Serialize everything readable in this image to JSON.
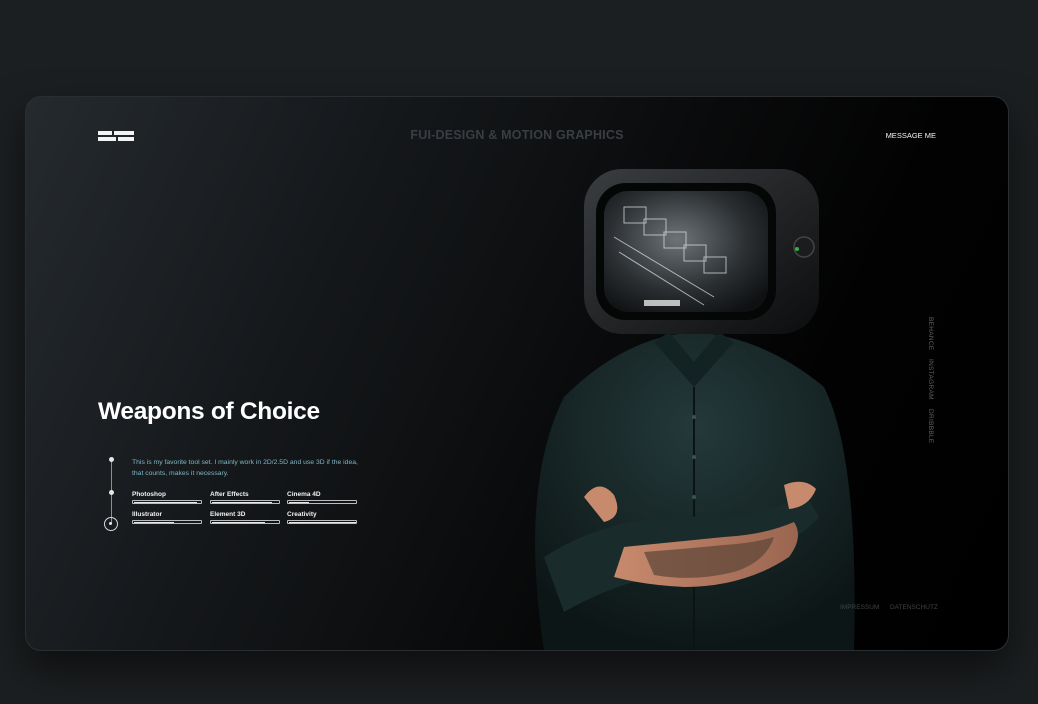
{
  "header": {
    "title": "FUI-DESIGN & MOTION GRAPHICS",
    "message_button": "MESSAGE ME"
  },
  "hero": {
    "heading": "Weapons of Choice",
    "description": "This is my favorite tool set. I mainly work in 2D/2.5D and use 3D if the idea, that counts, makes it necessary."
  },
  "skills": [
    {
      "name": "Photoshop",
      "level": 0.95
    },
    {
      "name": "After Effects",
      "level": 0.9
    },
    {
      "name": "Cinema 4D",
      "level": 0.3
    },
    {
      "name": "Illustrator",
      "level": 0.6
    },
    {
      "name": "Element 3D",
      "level": 0.8
    },
    {
      "name": "Creativity",
      "level": 1.0
    }
  ],
  "social": {
    "behance": "BEHANCE",
    "instagram": "INSTAGRAM",
    "dribbble": "DRIBBBLE"
  },
  "footer": {
    "impressum": "IMPRESSUM",
    "datenschutz": "DATENSCHUTZ"
  },
  "colors": {
    "background": "#1c1f21",
    "accent_text": "#7fb6c4",
    "shirt": "#1b2a2a"
  }
}
